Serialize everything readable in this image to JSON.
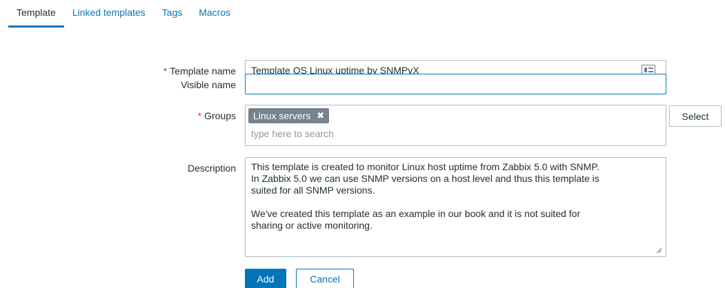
{
  "tabs": [
    {
      "label": "Template",
      "active": true
    },
    {
      "label": "Linked templates",
      "active": false
    },
    {
      "label": "Tags",
      "active": false
    },
    {
      "label": "Macros",
      "active": false
    }
  ],
  "form": {
    "required_marker": "*",
    "template_name": {
      "label": "Template name",
      "value": "Template OS Linux uptime by SNMPvX",
      "icon": "name-card-icon"
    },
    "visible_name": {
      "label": "Visible name",
      "value": ""
    },
    "groups": {
      "label": "Groups",
      "selected": [
        {
          "label": "Linux servers",
          "remove_icon": "close-icon"
        }
      ],
      "placeholder": "type here to search",
      "select_button": "Select"
    },
    "description": {
      "label": "Description",
      "value": "This template is created to monitor Linux host uptime from Zabbix 5.0 with SNMP.\nIn Zabbix 5.0 we can use SNMP versions on a host level and thus this template is\nsuited for all SNMP versions.\n\nWe've created this template as an example in our book and it is not suited for\nsharing or active monitoring."
    }
  },
  "actions": {
    "add": "Add",
    "cancel": "Cancel"
  },
  "colors": {
    "accent": "#0275b8",
    "required": "#e33734",
    "chip": "#76838e",
    "border": "#acbbc2"
  }
}
